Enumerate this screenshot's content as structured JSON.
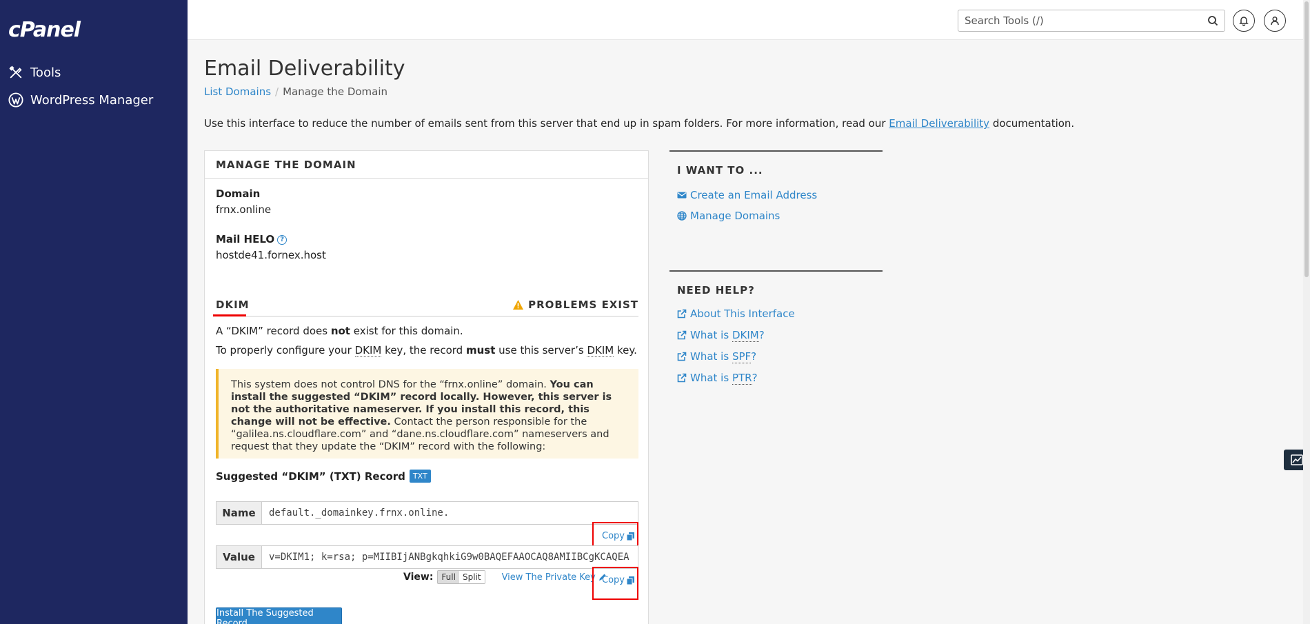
{
  "sidebar": {
    "logo": "cPanel",
    "items": [
      {
        "label": "Tools",
        "icon": "tools-icon"
      },
      {
        "label": "WordPress Manager",
        "icon": "wordpress-icon"
      }
    ]
  },
  "header": {
    "search_placeholder": "Search Tools (/)"
  },
  "page": {
    "title": "Email Deliverability",
    "breadcrumb": {
      "link": "List Domains",
      "separator": "/",
      "current": "Manage the Domain"
    },
    "intro_before": "Use this interface to reduce the number of emails sent from this server that end up in spam folders. For more information, read our ",
    "intro_link": "Email Deliverability",
    "intro_after": " documentation."
  },
  "panel": {
    "title": "MANAGE THE DOMAIN",
    "domain_label": "Domain",
    "domain_value": "frnx.online",
    "helo_label": "Mail HELO",
    "helo_value": "hostde41.fornex.host",
    "dkim_tab": "DKIM",
    "problems": "PROBLEMS EXIST",
    "line1_a": "A “DKIM” record does ",
    "line1_b": "not",
    "line1_c": " exist for this domain.",
    "line2_a": "To properly configure your ",
    "line2_abbr1": "DKIM",
    "line2_b": " key, the record ",
    "line2_c": "must",
    "line2_d": " use this server’s ",
    "line2_abbr2": "DKIM",
    "line2_e": " key.",
    "notice_a": "This system does not control DNS for the “frnx.online” domain. ",
    "notice_b": "You can install the suggested “DKIM” record locally. However, this server is not the authoritative nameserver. If you install this record, this change will not be effective.",
    "notice_c": " Contact the person responsible for the “galilea.ns.cloudflare.com” and “dane.ns.cloudflare.com” nameservers and request that they update the “DKIM” record with the following:",
    "suggested_label": "Suggested “DKIM” (TXT) Record",
    "badge": "TXT",
    "name_label": "Name",
    "name_value": "default._domainkey.frnx.online.",
    "value_label": "Value",
    "value_value": "v=DKIM1; k=rsa; p=MIIBIjANBgkqhkiG9w0BAQEFAAOCAQ8AMIIBCgKCAQEA",
    "copy_label": "Copy",
    "view_label": "View:",
    "view_full": "Full",
    "view_split": "Split",
    "private_key": "View The Private Key",
    "install_button": "Install The Suggested Record"
  },
  "side": {
    "want_title": "I WANT TO ...",
    "want_links": [
      {
        "label": "Create an Email Address",
        "icon": "envelope-icon"
      },
      {
        "label": "Manage Domains",
        "icon": "globe-icon"
      }
    ],
    "help_title": "NEED HELP?",
    "help_links": [
      {
        "label": "About This Interface",
        "prefix": "",
        "abbr": "",
        "suffix": ""
      },
      {
        "label": "",
        "prefix": "What is ",
        "abbr": "DKIM",
        "suffix": "?"
      },
      {
        "label": "",
        "prefix": "What is ",
        "abbr": "SPF",
        "suffix": "?"
      },
      {
        "label": "",
        "prefix": "What is ",
        "abbr": "PTR",
        "suffix": "?"
      }
    ]
  },
  "colors": {
    "sidebar": "#1e2760",
    "link": "#2f86c9",
    "highlight": "#e00000",
    "notice_bg": "#fdf6e3",
    "notice_border": "#f0b429"
  }
}
